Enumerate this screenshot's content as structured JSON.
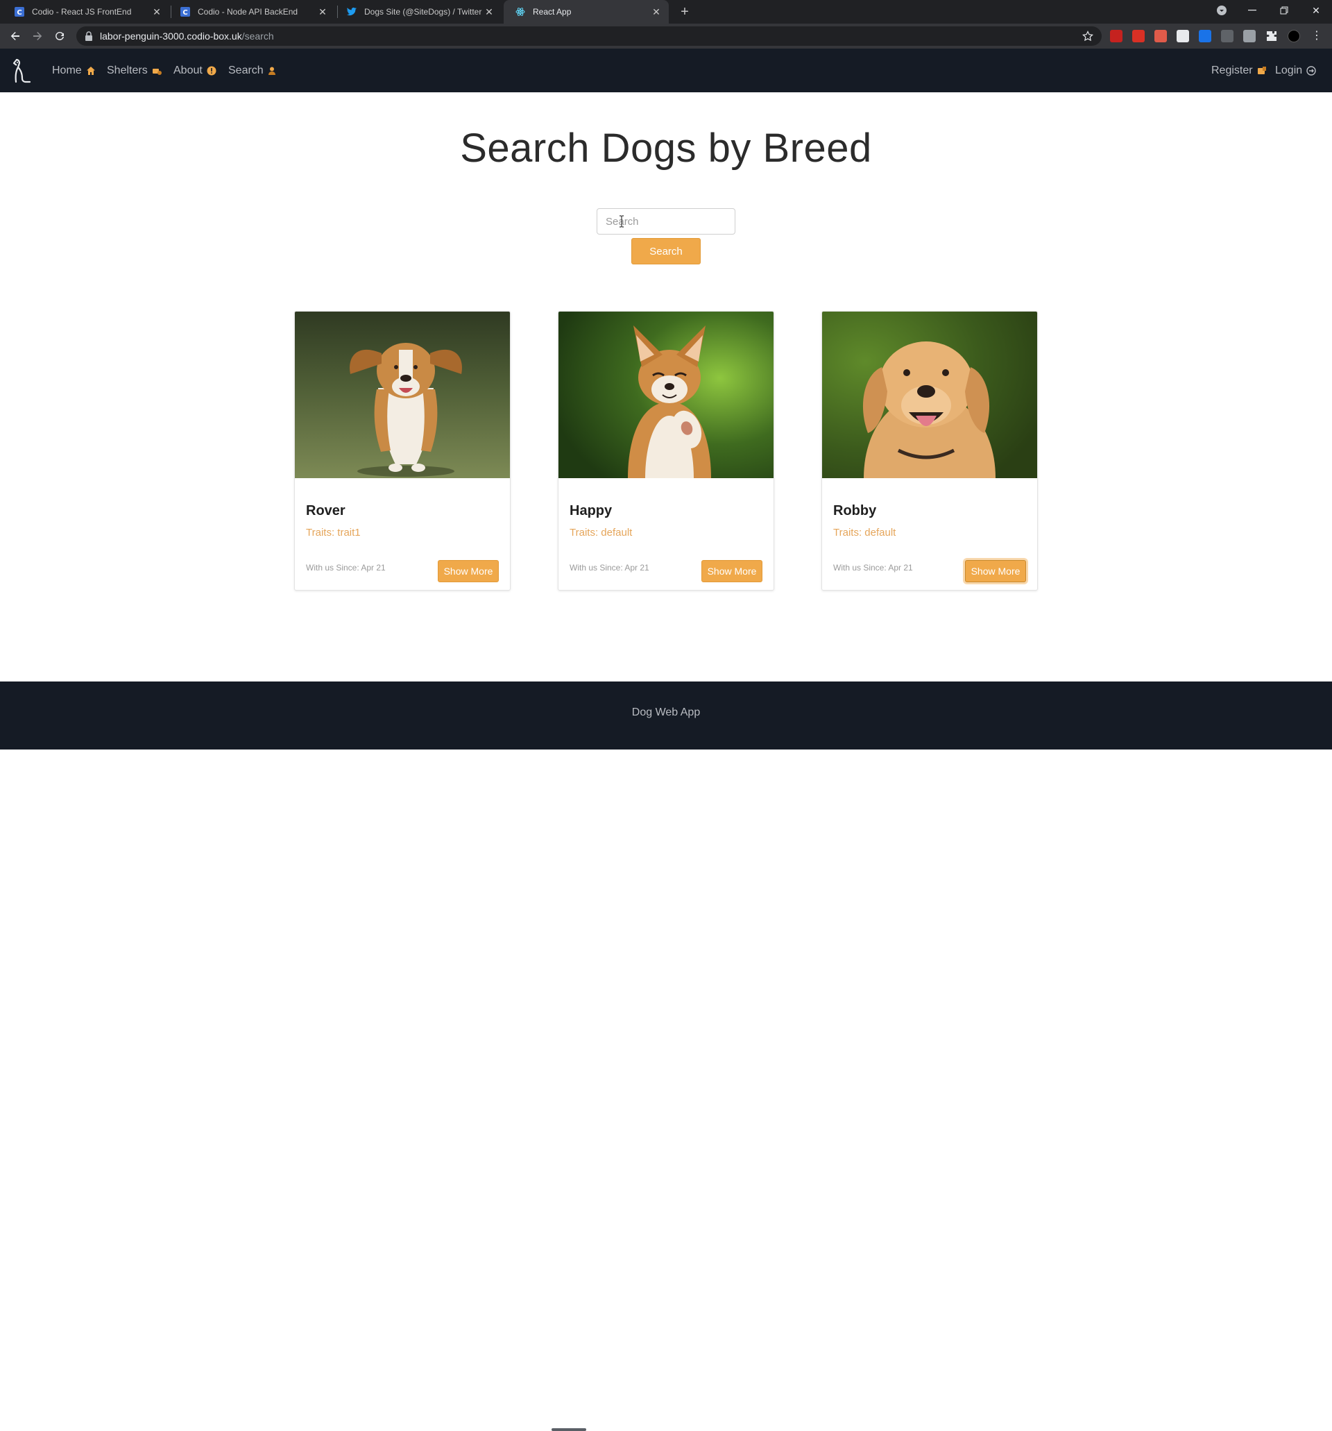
{
  "browser": {
    "tabs": [
      {
        "title": "Codio - React JS FrontEnd",
        "icon": "codio-icon"
      },
      {
        "title": "Codio - Node API BackEnd",
        "icon": "codio-icon"
      },
      {
        "title": "Dogs Site (@SiteDogs) / Twitter",
        "icon": "twitter-icon"
      },
      {
        "title": "React App",
        "icon": "react-icon"
      }
    ],
    "url_host": "labor-penguin-3000.codio-box.uk",
    "url_path": "/search"
  },
  "navbar": {
    "links": [
      {
        "label": "Home",
        "icon": "home-icon"
      },
      {
        "label": "Shelters",
        "icon": "shelter-icon"
      },
      {
        "label": "About",
        "icon": "info-icon"
      },
      {
        "label": "Search",
        "icon": "user-search-icon"
      }
    ],
    "right_links": [
      {
        "label": "Register",
        "icon": "register-icon"
      },
      {
        "label": "Login",
        "icon": "login-icon"
      }
    ]
  },
  "main": {
    "title": "Search Dogs by Breed",
    "search_placeholder": "Search",
    "search_button": "Search",
    "dogs": [
      {
        "name": "Rover",
        "traits": "Traits: trait1",
        "since": "With us Since: Apr 21",
        "button": "Show More"
      },
      {
        "name": "Happy",
        "traits": "Traits: default",
        "since": "With us Since: Apr 21",
        "button": "Show More"
      },
      {
        "name": "Robby",
        "traits": "Traits: default",
        "since": "With us Since: Apr 21",
        "button": "Show More"
      }
    ]
  },
  "footer": {
    "text": "Dog Web App"
  },
  "colors": {
    "accent": "#f0a94a",
    "nav_bg": "#151b25",
    "traits": "#e5a55a"
  }
}
